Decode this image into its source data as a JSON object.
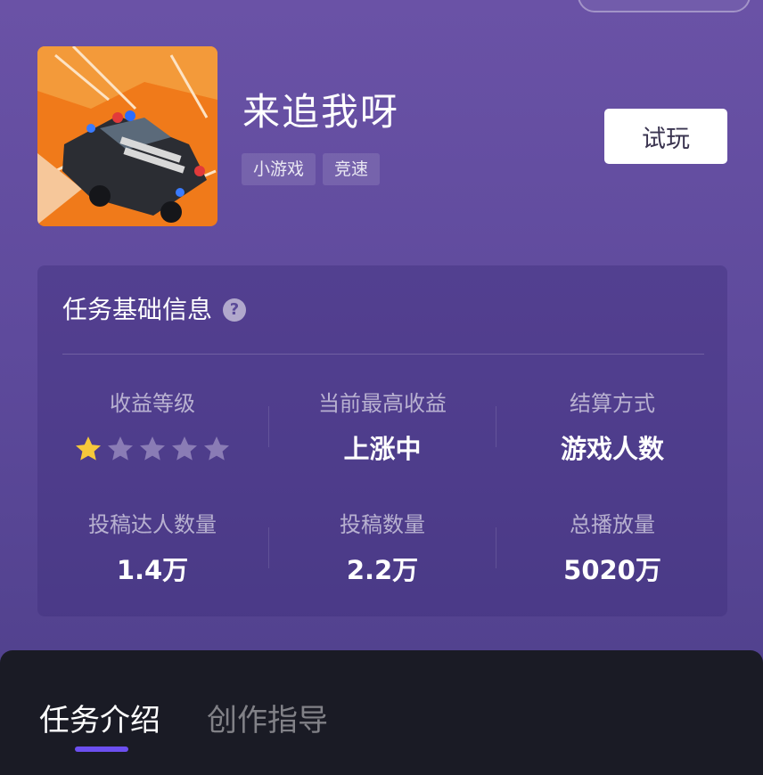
{
  "game": {
    "title": "来追我呀",
    "tags": [
      "小游戏",
      "竞速"
    ],
    "try_label": "试玩"
  },
  "task_info": {
    "title": "任务基础信息",
    "help_icon": "?",
    "stats": [
      {
        "label": "收益等级",
        "rating": 1,
        "rating_max": 5
      },
      {
        "label": "当前最高收益",
        "value": "上涨中"
      },
      {
        "label": "结算方式",
        "value": "游戏人数"
      },
      {
        "label": "投稿达人数量",
        "value": "1.4万"
      },
      {
        "label": "投稿数量",
        "value": "2.2万"
      },
      {
        "label": "总播放量",
        "value": "5020万"
      }
    ]
  },
  "tabs": [
    {
      "label": "任务介绍",
      "active": true
    },
    {
      "label": "创作指导",
      "active": false
    }
  ],
  "colors": {
    "accent": "#6c4ff0",
    "star_filled": "#f6c83a",
    "star_empty": "#8a7cb5"
  }
}
